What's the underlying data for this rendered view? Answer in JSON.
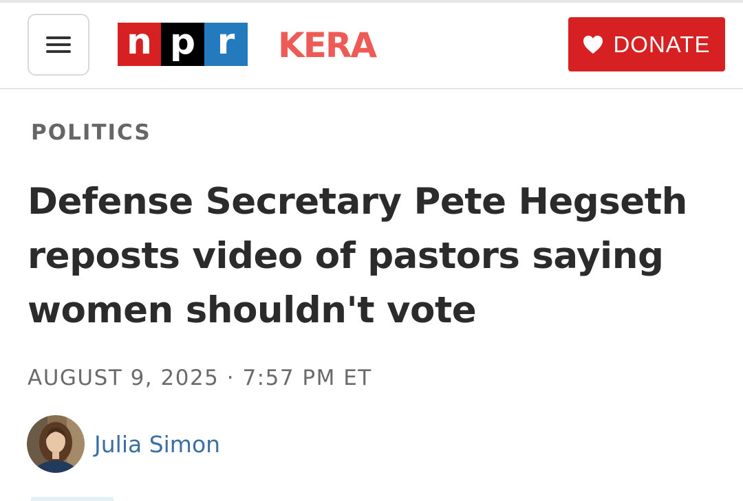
{
  "header": {
    "menu_icon": "hamburger-menu-icon",
    "npr_logo": {
      "letters": [
        "n",
        "p",
        "r"
      ],
      "colors": [
        "#d62021",
        "#000000",
        "#237bbd"
      ]
    },
    "station_logo": {
      "text": "KERA",
      "color": "#ee5a55"
    },
    "donate": {
      "label": "DONATE",
      "icon": "heart-icon",
      "color": "#d62021"
    }
  },
  "article": {
    "section": "POLITICS",
    "headline": "Defense Secretary Pete Hegseth reposts video of pastors saying women shouldn't vote",
    "dateline": "AUGUST 9, 2025 · 7:57 PM ET",
    "author": {
      "name": "Julia Simon",
      "avatar_icon": "author-avatar",
      "link_color": "#3a6ea5"
    }
  }
}
